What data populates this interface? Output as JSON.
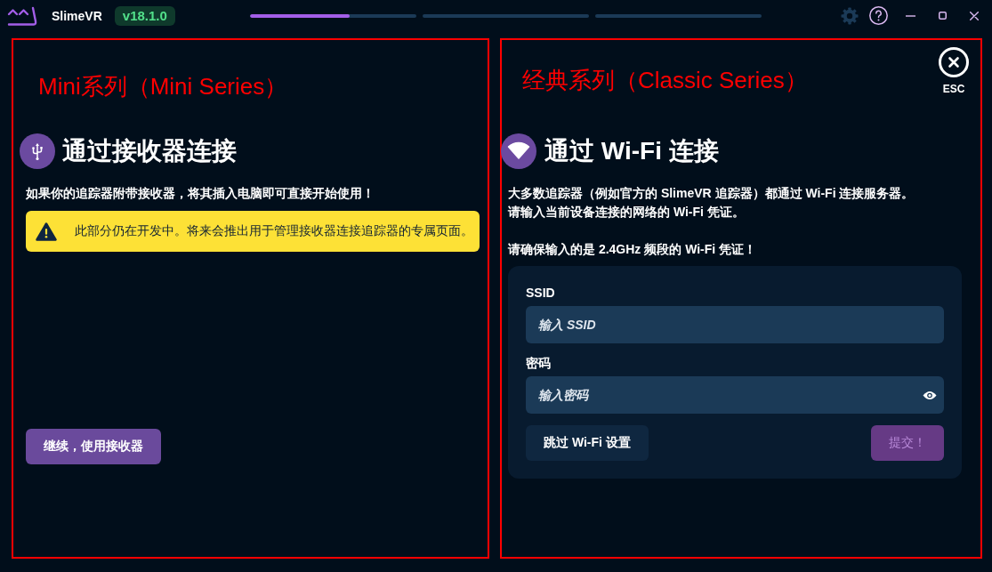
{
  "app_bar": {
    "title": "SlimeVR",
    "version": "v18.1.0",
    "steps": [
      {
        "level": 0.6
      },
      {
        "level": 0
      },
      {
        "level": 0
      }
    ]
  },
  "panels": [
    {
      "kind": "receiver",
      "annotation": "Mini系列（Mini Series）",
      "title": "通过接收器连接",
      "description": [
        "如果你的追踪器附带接收器，将其插入电脑即可直接开始使用！"
      ],
      "warning": "此部分仍在开发中。将来会推出用于管理接收器连接追踪器的专属页面。",
      "button": {
        "label": "继续，使用接收器"
      }
    },
    {
      "kind": "wifi",
      "annotation": "经典系列（Classic Series）",
      "close": {
        "label": "ESC"
      },
      "title": "通过 Wi-Fi 连接",
      "description": [
        "大多数追踪器（例如官方的 SlimeVR 追踪器）都通过 Wi-Fi 连接服务器。",
        "请输入当前设备连接的网络的 Wi-Fi 凭证。"
      ],
      "note": "请确保输入的是 2.4GHz 频段的 Wi-Fi 凭证！",
      "form": {
        "fields": [
          {
            "kind": "text",
            "label": "SSID",
            "placeholder": "输入 SSID"
          },
          {
            "kind": "password",
            "label": "密码",
            "placeholder": "输入密码"
          }
        ],
        "buttons": [
          {
            "kind": "secondary",
            "label": "跳过 Wi-Fi 设置",
            "disabled": false
          },
          {
            "kind": "primary",
            "label": "提交！",
            "disabled": true
          }
        ]
      }
    }
  ]
}
